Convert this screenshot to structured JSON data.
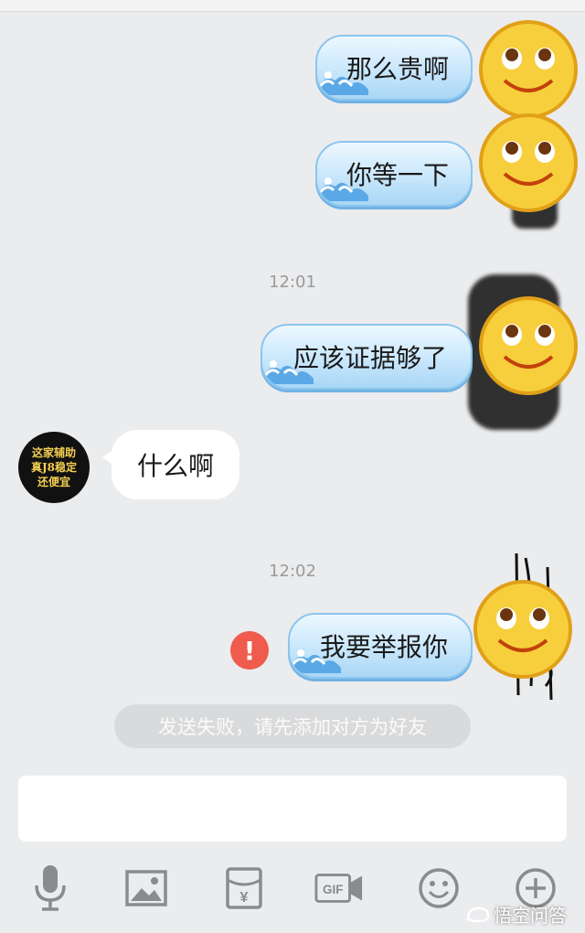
{
  "messages": {
    "m1": "那么贵啊",
    "m2": "你等一下",
    "m3": "应该证据够了",
    "m4": "什么啊",
    "m5": "我要举报你"
  },
  "timestamps": {
    "t1": "12:01",
    "t2": "12:02"
  },
  "contact_avatar": {
    "line1": "这家辅助",
    "line2": "真J8稳定",
    "line3": "还便宜"
  },
  "error_badge": "!",
  "notice": "发送失败，请先添加对方为好友",
  "input": {
    "value": ""
  },
  "toolbar": {
    "icons": [
      "microphone-icon",
      "image-icon",
      "red-packet-icon",
      "gif-icon",
      "emoji-icon",
      "plus-icon"
    ],
    "red_packet_symbol": "¥",
    "gif_label": "GIF"
  },
  "watermark": "悟空问答",
  "colors": {
    "error": "#ef5b4c",
    "bubble_blue": "#cfeafd",
    "background": "#ebecee",
    "icon_gray": "#8a8b8d"
  }
}
